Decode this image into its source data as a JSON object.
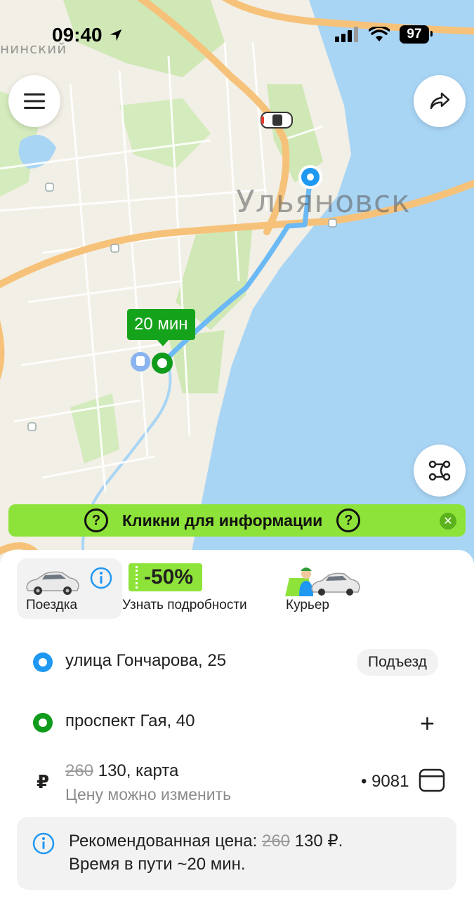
{
  "status_bar": {
    "time": "09:40",
    "battery": "97"
  },
  "map": {
    "city_label": "Ульяновск",
    "district_label": "нинский",
    "eta_label": "20 мин"
  },
  "promo_banner": {
    "text": "Кликни для информации"
  },
  "tariffs": [
    {
      "label": "Поездка",
      "selected": true
    },
    {
      "label": "Узнать подробности",
      "badge": "-50%"
    },
    {
      "label": "Курьер"
    }
  ],
  "route": {
    "from": {
      "address": "улица Гончарова, 25",
      "action": "Подъезд"
    },
    "to": {
      "address": "проспект Гая, 40"
    }
  },
  "payment": {
    "currency_symbol": "₽",
    "old_price": "260",
    "price_text": "130, карта",
    "hint": "Цену можно изменить",
    "card_mask": "• 9081"
  },
  "recommendation": {
    "label": "Рекомендованная цена:",
    "old_price": "260",
    "price": "130 ₽.",
    "travel_time": "Время в пути ~20 мин."
  },
  "colors": {
    "accent_green": "#8ee33a",
    "route_blue": "#1f98f2",
    "destination_green": "#0f9b1c",
    "water": "#a9d5f5"
  }
}
